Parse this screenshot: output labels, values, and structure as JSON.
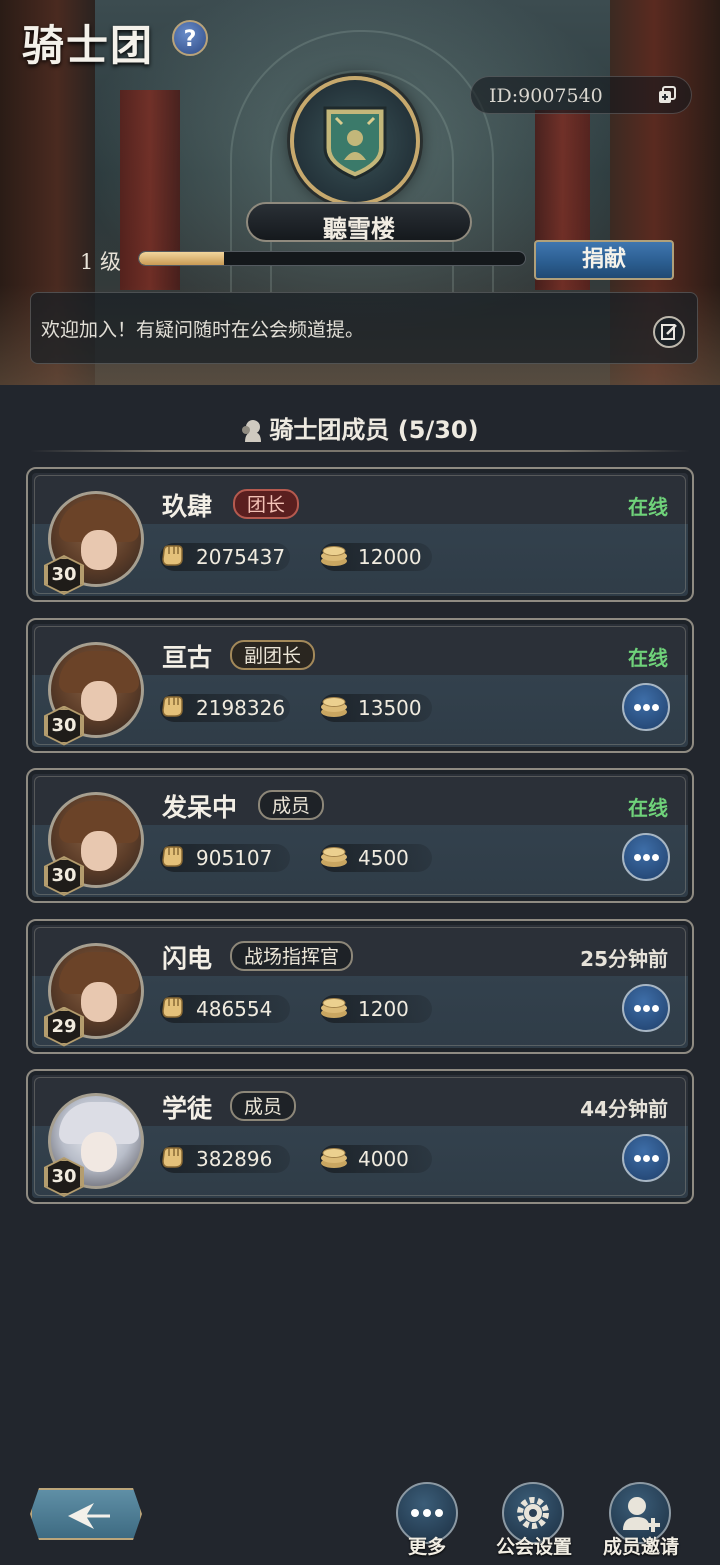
{
  "header": {
    "title": "骑士团",
    "guild_id": "ID:9007540",
    "guild_name": "聽雪楼",
    "level_label": "1 级",
    "level_progress": 0.22,
    "donate_label": "捐献",
    "notice": "欢迎加入！有疑问随时在公会频道提。"
  },
  "members_section": {
    "title": "骑士团成员 (5/30)"
  },
  "members": [
    {
      "name": "玖肆",
      "role": "团长",
      "status": "在线",
      "level": "30",
      "power": "2075437",
      "contribution": "12000"
    },
    {
      "name": "亘古",
      "role": "副团长",
      "status": "在线",
      "level": "30",
      "power": "2198326",
      "contribution": "13500"
    },
    {
      "name": "发呆中",
      "role": "成员",
      "status": "在线",
      "level": "30",
      "power": "905107",
      "contribution": "4500"
    },
    {
      "name": "闪电",
      "role": "战场指挥官",
      "status": "25分钟前",
      "level": "29",
      "power": "486554",
      "contribution": "1200"
    },
    {
      "name": "学徒",
      "role": "成员",
      "status": "44分钟前",
      "level": "30",
      "power": "382896",
      "contribution": "4000"
    }
  ],
  "bottom_nav": {
    "more": "更多",
    "guild_settings": "公会设置",
    "invite": "成员邀请"
  },
  "colors": {
    "online": "#6fd27a",
    "accent_gold": "#c7a96d",
    "button_blue": "#2a5c8e"
  }
}
